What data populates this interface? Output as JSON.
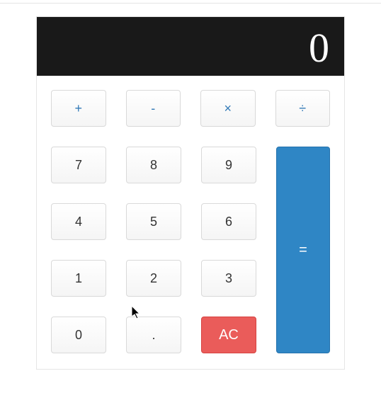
{
  "display": {
    "value": "0"
  },
  "operators": {
    "add": "+",
    "subtract": "-",
    "multiply": "×",
    "divide": "÷"
  },
  "digits": {
    "seven": "7",
    "eight": "8",
    "nine": "9",
    "four": "4",
    "five": "5",
    "six": "6",
    "one": "1",
    "two": "2",
    "three": "3",
    "zero": "0",
    "decimal": "."
  },
  "actions": {
    "clear": "AC",
    "equals": "="
  }
}
